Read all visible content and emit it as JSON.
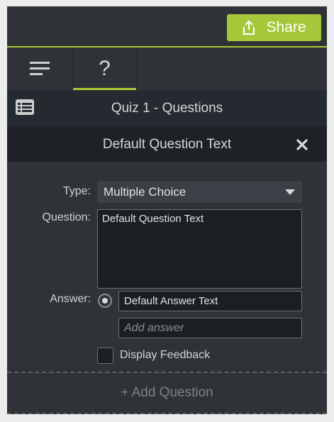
{
  "toolbar": {
    "share_label": "Share"
  },
  "tabs": [
    {
      "name": "properties-list",
      "icon": "hamburger-menu-icon"
    },
    {
      "name": "quiz",
      "label": "?",
      "active": true
    }
  ],
  "quiz": {
    "title": "Quiz 1 - Questions",
    "icon": "list-card-icon"
  },
  "question": {
    "header_title": "Default Question Text",
    "type_label": "Type:",
    "type_value": "Multiple Choice",
    "question_label": "Question:",
    "question_text": "Default Question Text",
    "answer_label": "Answer:",
    "answers": [
      "Default Answer Text"
    ],
    "add_answer_placeholder": "Add answer",
    "display_feedback_label": "Display Feedback",
    "display_feedback_checked": false
  },
  "footer": {
    "add_question_label": "+ Add Question"
  },
  "colors": {
    "accent": "#a8c936",
    "panel_bg": "#2f3338",
    "header_bg": "#252a30",
    "input_bg": "#1b1f24"
  }
}
